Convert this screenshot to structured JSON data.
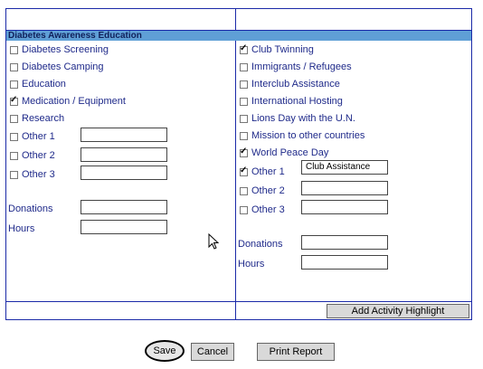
{
  "header": {
    "title": "Diabetes Awareness Education"
  },
  "left": {
    "items": [
      {
        "label": "Diabetes Screening",
        "checked": false
      },
      {
        "label": "Diabetes Camping",
        "checked": false
      },
      {
        "label": "Education",
        "checked": false
      },
      {
        "label": "Medication / Equipment",
        "checked": true
      },
      {
        "label": "Research",
        "checked": false
      },
      {
        "label": "Other 1",
        "checked": false
      },
      {
        "label": "Other 2",
        "checked": false
      },
      {
        "label": "Other 3",
        "checked": false
      }
    ],
    "donations_label": "Donations",
    "hours_label": "Hours"
  },
  "right": {
    "items": [
      {
        "label": "Club Twinning",
        "checked": true
      },
      {
        "label": "Immigrants / Refugees",
        "checked": false
      },
      {
        "label": "Interclub Assistance",
        "checked": false
      },
      {
        "label": "International Hosting",
        "checked": false
      },
      {
        "label": "Lions Day with the U.N.",
        "checked": false
      },
      {
        "label": "Mission to other countries",
        "checked": false
      },
      {
        "label": "World Peace Day",
        "checked": true
      },
      {
        "label": "Other 1",
        "checked": true
      },
      {
        "label": "Other 2",
        "checked": false
      },
      {
        "label": "Other 3",
        "checked": false
      }
    ],
    "other1_value": "Club Assistance",
    "donations_label": "Donations",
    "hours_label": "Hours"
  },
  "buttons": {
    "add_highlight": "Add Activity Highlight",
    "save": "Save",
    "cancel": "Cancel",
    "print": "Print Report"
  }
}
